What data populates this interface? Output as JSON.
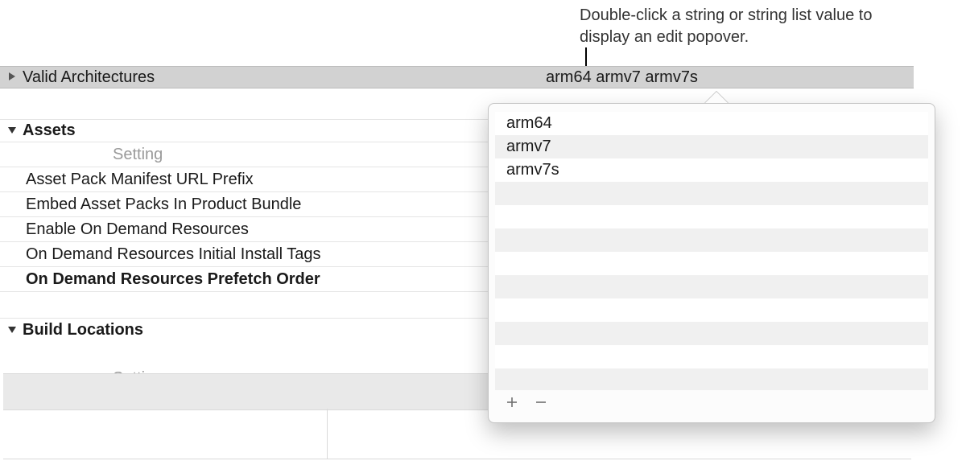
{
  "annotation": {
    "text": "Double-click a string or string list value to display an edit popover."
  },
  "architectures_row": {
    "label": "Valid Architectures",
    "value": "arm64 armv7 armv7s"
  },
  "sections": {
    "assets": {
      "title": "Assets",
      "column_header": "Setting",
      "rows": [
        {
          "label": "Asset Pack Manifest URL Prefix",
          "bold": false
        },
        {
          "label": "Embed Asset Packs In Product Bundle",
          "bold": false
        },
        {
          "label": "Enable On Demand Resources",
          "bold": false
        },
        {
          "label": "On Demand Resources Initial Install Tags",
          "bold": false
        },
        {
          "label": "On Demand Resources Prefetch Order",
          "bold": true
        }
      ]
    },
    "build_locations": {
      "title": "Build Locations",
      "column_header": "Setting"
    }
  },
  "popover": {
    "items": [
      "arm64",
      "armv7",
      "armv7s"
    ],
    "total_visible_rows": 12,
    "add_icon": "plus-icon",
    "remove_icon": "minus-icon"
  }
}
